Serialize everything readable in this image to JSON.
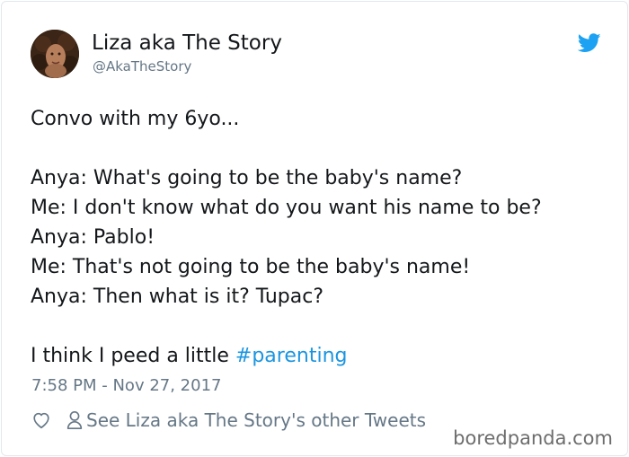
{
  "author": {
    "display_name": "Liza aka The Story",
    "handle": "@AkaTheStory",
    "avatar_icon": "profile-photo"
  },
  "platform_icon": "twitter-bird-icon",
  "accent_color": "#1b95e0",
  "tweet": {
    "lines": [
      "Convo with my 6yo...",
      "",
      "Anya: What's going to be the baby's name?",
      "Me: I don't know what do you want his name to be?",
      "Anya: Pablo!",
      "Me: That's not going to be the baby's name!",
      "Anya: Then what is it? Tupac?",
      ""
    ],
    "last_line_text": "I think I peed a little ",
    "hashtag": "#parenting",
    "timestamp": "7:58 PM - Nov 27, 2017"
  },
  "actions": {
    "like_icon": "heart-icon",
    "profile_icon": "person-icon",
    "other_tweets_label": "See Liza aka The Story's other Tweets"
  },
  "watermark": "boredpanda.com"
}
